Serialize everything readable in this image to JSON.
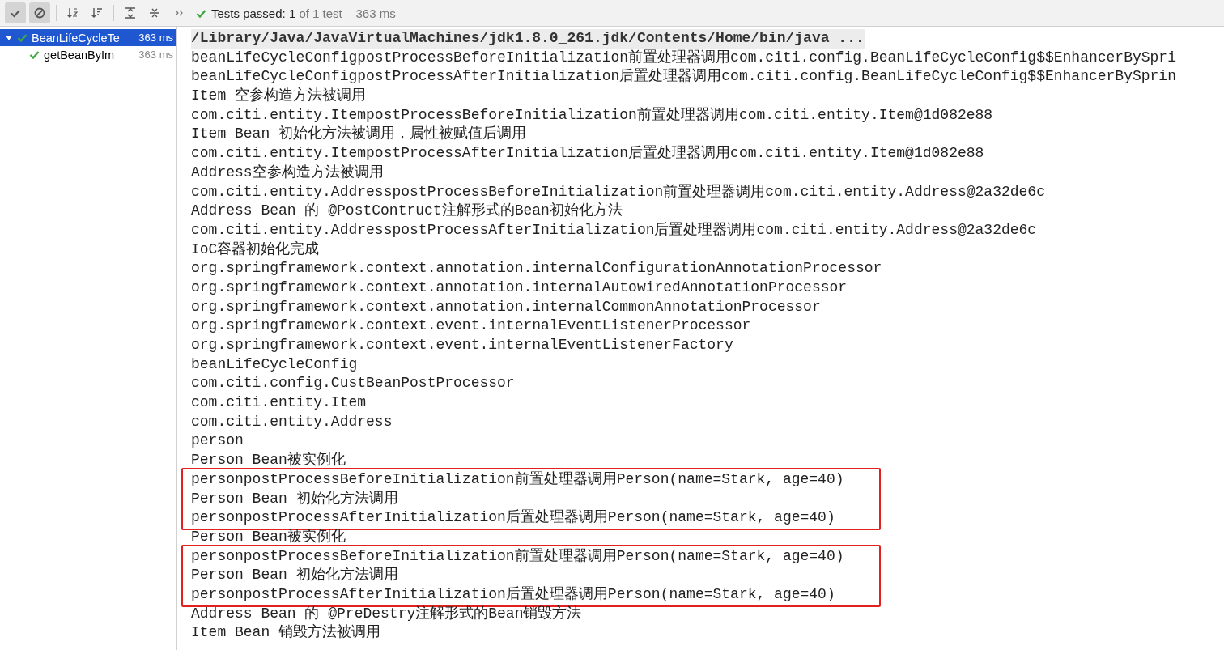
{
  "toolbar": {
    "buttons": [
      {
        "kind": "passed",
        "on": true
      },
      {
        "kind": "ignored",
        "on": true
      },
      {
        "kind": "sort-alpha",
        "on": false
      },
      {
        "kind": "sort-duration",
        "on": false
      },
      {
        "kind": "expand",
        "on": false
      },
      {
        "kind": "collapse",
        "on": false
      },
      {
        "kind": "more",
        "on": false
      }
    ],
    "status": {
      "label": "Tests passed:",
      "count": "1",
      "detail": "of 1 test – 363 ms"
    }
  },
  "tree": {
    "items": [
      {
        "name": "BeanLifeCycleTe",
        "time": "363 ms",
        "selected": true,
        "expanded": true,
        "passed": true,
        "children": [
          {
            "name": "getBeanByIm",
            "time": "363 ms",
            "selected": false,
            "passed": true
          }
        ]
      }
    ]
  },
  "console": {
    "command": "/Library/Java/JavaVirtualMachines/jdk1.8.0_261.jdk/Contents/Home/bin/java ...",
    "lines": [
      {
        "text": "beanLifeCycleConfigpostProcessBeforeInitialization前置处理器调用com.citi.config.BeanLifeCycleConfig$$EnhancerBySpri",
        "boxed": false
      },
      {
        "text": "beanLifeCycleConfigpostProcessAfterInitialization后置处理器调用com.citi.config.BeanLifeCycleConfig$$EnhancerBySprin",
        "boxed": false
      },
      {
        "text": "Item 空参构造方法被调用",
        "boxed": false
      },
      {
        "text": "com.citi.entity.ItempostProcessBeforeInitialization前置处理器调用com.citi.entity.Item@1d082e88",
        "boxed": false
      },
      {
        "text": "Item Bean 初始化方法被调用，属性被赋值后调用",
        "boxed": false
      },
      {
        "text": "com.citi.entity.ItempostProcessAfterInitialization后置处理器调用com.citi.entity.Item@1d082e88",
        "boxed": false
      },
      {
        "text": "Address空参构造方法被调用",
        "boxed": false
      },
      {
        "text": "com.citi.entity.AddresspostProcessBeforeInitialization前置处理器调用com.citi.entity.Address@2a32de6c",
        "boxed": false
      },
      {
        "text": "Address Bean 的 @PostContruct注解形式的Bean初始化方法",
        "boxed": false
      },
      {
        "text": "com.citi.entity.AddresspostProcessAfterInitialization后置处理器调用com.citi.entity.Address@2a32de6c",
        "boxed": false
      },
      {
        "text": "IoC容器初始化完成",
        "boxed": false
      },
      {
        "text": "org.springframework.context.annotation.internalConfigurationAnnotationProcessor",
        "boxed": false
      },
      {
        "text": "org.springframework.context.annotation.internalAutowiredAnnotationProcessor",
        "boxed": false
      },
      {
        "text": "org.springframework.context.annotation.internalCommonAnnotationProcessor",
        "boxed": false
      },
      {
        "text": "org.springframework.context.event.internalEventListenerProcessor",
        "boxed": false
      },
      {
        "text": "org.springframework.context.event.internalEventListenerFactory",
        "boxed": false
      },
      {
        "text": "beanLifeCycleConfig",
        "boxed": false
      },
      {
        "text": "com.citi.config.CustBeanPostProcessor",
        "boxed": false
      },
      {
        "text": "com.citi.entity.Item",
        "boxed": false
      },
      {
        "text": "com.citi.entity.Address",
        "boxed": false
      },
      {
        "text": "person",
        "boxed": false
      },
      {
        "text": "Person Bean被实例化",
        "boxed": false
      },
      {
        "text": "personpostProcessBeforeInitialization前置处理器调用Person(name=Stark, age=40)",
        "boxed": true
      },
      {
        "text": "Person Bean 初始化方法调用",
        "boxed": true
      },
      {
        "text": "personpostProcessAfterInitialization后置处理器调用Person(name=Stark, age=40)",
        "boxed": true
      },
      {
        "text": "Person Bean被实例化",
        "boxed": false
      },
      {
        "text": "personpostProcessBeforeInitialization前置处理器调用Person(name=Stark, age=40)",
        "boxed": true
      },
      {
        "text": "Person Bean 初始化方法调用",
        "boxed": true
      },
      {
        "text": "personpostProcessAfterInitialization后置处理器调用Person(name=Stark, age=40)",
        "boxed": true
      },
      {
        "text": "Address Bean 的 @PreDestry注解形式的Bean销毁方法",
        "boxed": false
      },
      {
        "text": "Item Bean 销毁方法被调用",
        "boxed": false
      }
    ]
  }
}
